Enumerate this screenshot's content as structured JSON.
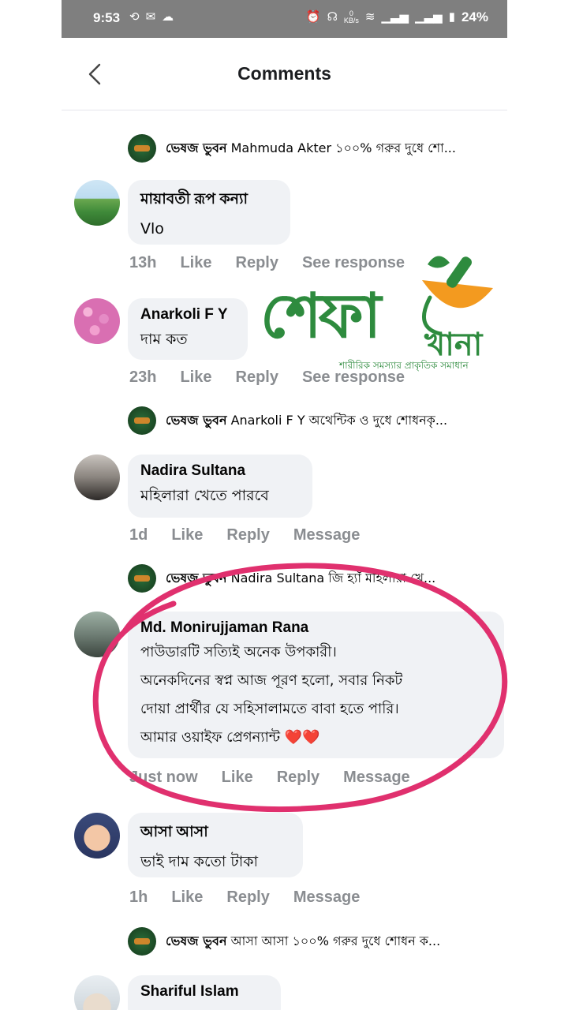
{
  "status_bar": {
    "time": "9:53",
    "speed_value": "0",
    "speed_unit": "KB/s",
    "battery": "24%"
  },
  "header": {
    "title": "Comments"
  },
  "reply_previews": [
    {
      "name": "ভেষজ ভুবন",
      "text": "Mahmuda Akter ১০০% গরুর দুধে শো..."
    },
    {
      "name": "ভেষজ ভুবন",
      "text": "Anarkoli F Y অথেন্টিক ও দুধে শোধনকৃ..."
    },
    {
      "name": "ভেষজ ভুবন",
      "text": "Nadira Sultana জি হ্যাঁ মহিলারা খে..."
    },
    {
      "name": "ভেষজ ভুবন",
      "text": "আসা আসা ১০০% গরুর দুধে শোধন ক..."
    }
  ],
  "comments": [
    {
      "name": "মায়াবতী রূপ কন্যা",
      "text": "Vlo",
      "time": "13h",
      "like": "Like",
      "reply": "Reply",
      "extra": "See response"
    },
    {
      "name": "Anarkoli F Y",
      "text": "দাম কত",
      "time": "23h",
      "like": "Like",
      "reply": "Reply",
      "extra": "See response"
    },
    {
      "name": "Nadira Sultana",
      "text": "মহিলারা খেতে পারবে",
      "time": "1d",
      "like": "Like",
      "reply": "Reply",
      "extra": "Message"
    },
    {
      "name": "Md. Monirujjaman Rana",
      "text": "পাউডারটি সত্যিই অনেক উপকারী।\nঅনেকদিনের স্বপ্ন আজ পূরণ হলো, সবার নিকট\nদোয়া প্রার্থীর যে সহিসালামতে বাবা হতে পারি।\nআমার ওয়াইফ প্রেগন্যান্ট ❤️❤️",
      "time": "Just now",
      "like": "Like",
      "reply": "Reply",
      "extra": "Message"
    },
    {
      "name": "আসা আসা",
      "text": "ভাই দাম কতো টাকা",
      "time": "1h",
      "like": "Like",
      "reply": "Reply",
      "extra": "Message"
    },
    {
      "name": "Shariful Islam",
      "text": "",
      "time": "",
      "like": "",
      "reply": "",
      "extra": ""
    }
  ],
  "watermark": {
    "big": "শেফা",
    "small": "খানা",
    "tagline": "শারীরিক সমস্যার প্রাকৃতিক সমাধান"
  },
  "colors": {
    "status_bar_bg": "#7f7f7f",
    "bubble_bg": "#f0f2f5",
    "action_text": "#8a8d91",
    "highlight_circle": "#e0306e",
    "logo_green": "#2e8b3e",
    "logo_orange": "#f39a1f"
  }
}
